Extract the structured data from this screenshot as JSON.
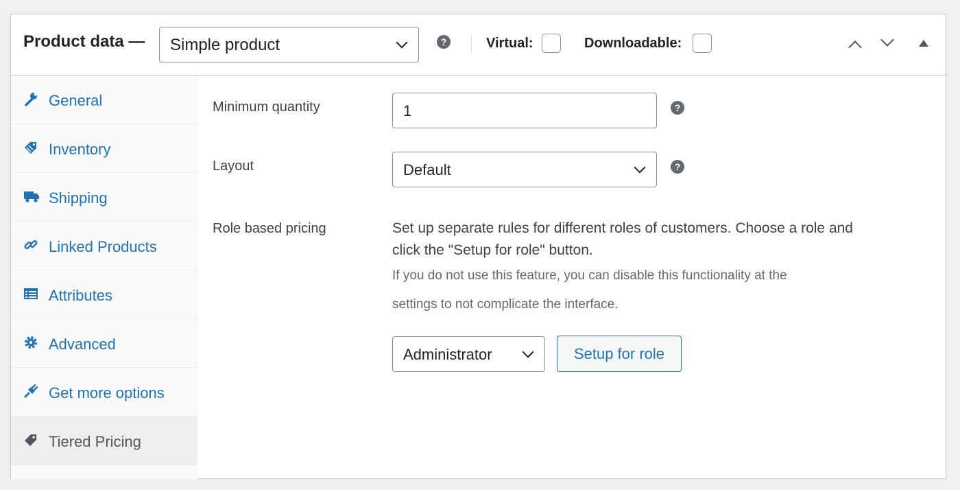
{
  "header": {
    "title": "Product data —",
    "product_type": "Simple product",
    "virtual_label": "Virtual:",
    "downloadable_label": "Downloadable:",
    "virtual_checked": false,
    "downloadable_checked": false
  },
  "sidebar": {
    "items": [
      {
        "label": "General",
        "icon": "wrench-icon"
      },
      {
        "label": "Inventory",
        "icon": "tag-icon"
      },
      {
        "label": "Shipping",
        "icon": "truck-icon"
      },
      {
        "label": "Linked Products",
        "icon": "link-icon"
      },
      {
        "label": "Attributes",
        "icon": "list-icon"
      },
      {
        "label": "Advanced",
        "icon": "gear-icon"
      },
      {
        "label": "Get more options",
        "icon": "plugin-icon"
      },
      {
        "label": "Tiered Pricing",
        "icon": "price-tag-icon",
        "active": true
      }
    ]
  },
  "main": {
    "min_qty_label": "Minimum quantity",
    "min_qty_value": "1",
    "layout_label": "Layout",
    "layout_value": "Default",
    "role_pricing_label": "Role based pricing",
    "role_desc_line1": "Set up separate rules for different roles of customers. Choose a role and",
    "role_desc_line2": "click the \"Setup for role\" button.",
    "role_note_line1": "If you do not use this feature, you can disable this functionality at the",
    "role_note_line2": "settings to not complicate the interface.",
    "role_select_value": "Administrator",
    "setup_button": "Setup for role"
  },
  "colors": {
    "link": "#2271b1",
    "border": "#c3c4c7",
    "text": "#1d2327",
    "muted": "#646970"
  }
}
